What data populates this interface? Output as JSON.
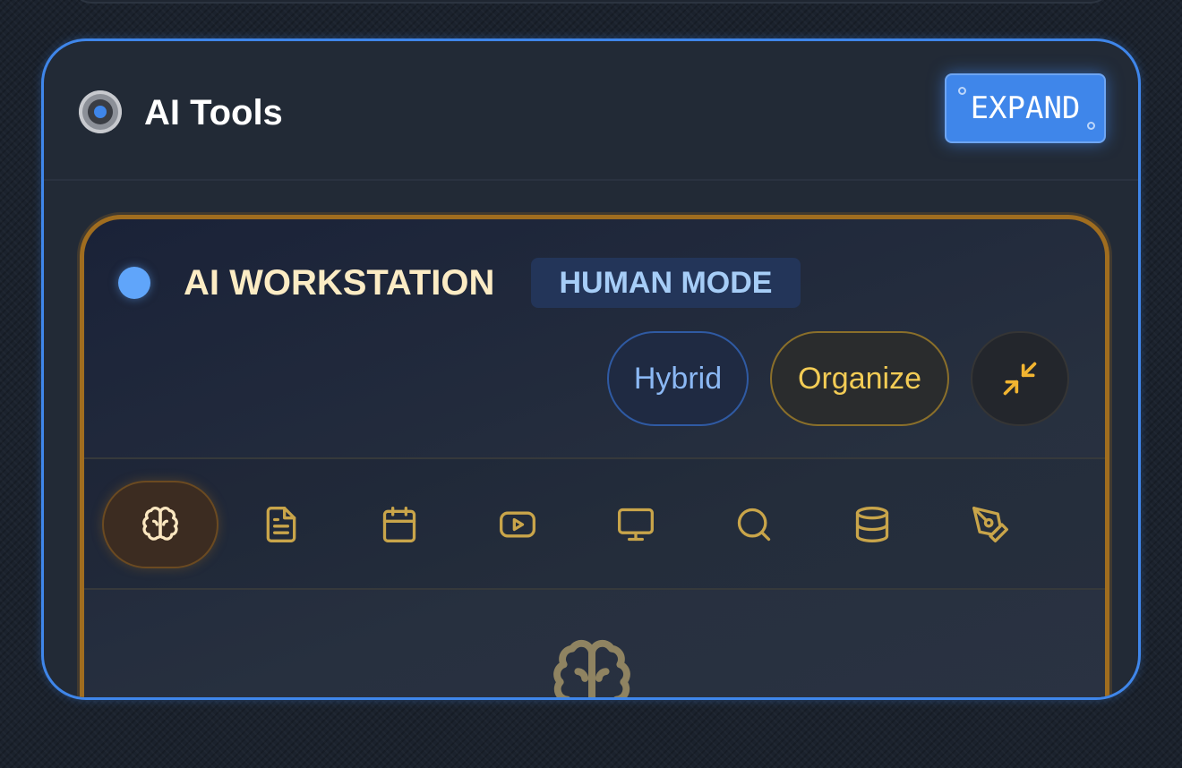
{
  "panel": {
    "title": "AI Tools",
    "expand_label": "EXPAND"
  },
  "workstation": {
    "title": "AI WORKSTATION",
    "mode_badge": "HUMAN MODE",
    "actions": [
      {
        "label": "Hybrid"
      },
      {
        "label": "Organize"
      }
    ],
    "tools": [
      {
        "icon": "brain-icon",
        "active": true
      },
      {
        "icon": "document-icon",
        "active": false
      },
      {
        "icon": "calendar-icon",
        "active": false
      },
      {
        "icon": "video-icon",
        "active": false
      },
      {
        "icon": "monitor-icon",
        "active": false
      },
      {
        "icon": "search-icon",
        "active": false
      },
      {
        "icon": "database-icon",
        "active": false
      },
      {
        "icon": "pen-tool-icon",
        "active": false
      }
    ]
  },
  "colors": {
    "accent": "#3f86ea",
    "gold": "#e2b13d",
    "badge_blue": "#a6cdf7"
  }
}
